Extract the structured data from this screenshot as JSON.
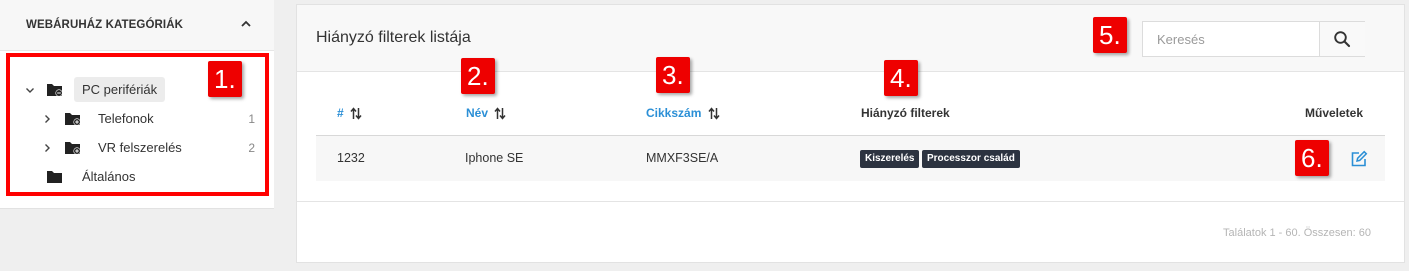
{
  "sidebar": {
    "title": "WEBÁRUHÁZ KATEGÓRIÁK",
    "items": [
      {
        "label": "PC perifériák",
        "count": ""
      },
      {
        "label": "Telefonok",
        "count": "1"
      },
      {
        "label": "VR felszerelés",
        "count": "2"
      },
      {
        "label": "Általános",
        "count": ""
      }
    ]
  },
  "main": {
    "title": "Hiányzó filterek listája",
    "search": {
      "placeholder": "Keresés",
      "value": ""
    },
    "columns": {
      "id": "#",
      "name": "Név",
      "sku": "Cikkszám",
      "missing": "Hiányzó filterek",
      "actions": "Műveletek"
    },
    "rows": [
      {
        "id": "1232",
        "name": "Iphone SE",
        "sku": "MMXF3SE/A",
        "tags": [
          "Kiszerelés",
          "Processzor család"
        ]
      }
    ],
    "footer": "Találatok 1 - 60. Összesen: 60"
  },
  "annotations": [
    "1.",
    "2.",
    "3.",
    "4.",
    "5.",
    "6."
  ],
  "colors": {
    "accent": "#2b8fd6",
    "annotation": "#ee0000",
    "tag_bg": "#2c3340"
  }
}
